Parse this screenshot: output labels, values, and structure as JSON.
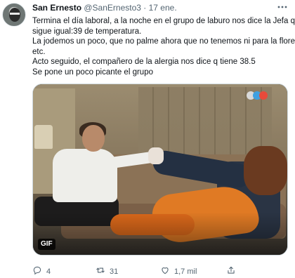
{
  "user": {
    "display_name": "San Ernesto",
    "handle": "@SanErnesto3",
    "separator": "·",
    "date": "17 ene."
  },
  "tweet": {
    "lines": [
      "Termina el día laboral, a la noche en el grupo de laburo nos dice la Jefa q",
      "sigue igual:39 de temperatura.",
      "La jodemos un poco, que no palme ahora que no tenemos ni para la flores,",
      "etc.",
      "Acto seguido, el compañero de la alergia nos dice q tiene 38.5",
      "Se pone un poco picante el grupo"
    ]
  },
  "media": {
    "badge": "GIF"
  },
  "actions": {
    "reply_count": "4",
    "retweet_count": "31",
    "like_count": "1,7 mil",
    "share_count": ""
  },
  "colors": {
    "text": "#0f1419",
    "secondary": "#536471"
  }
}
